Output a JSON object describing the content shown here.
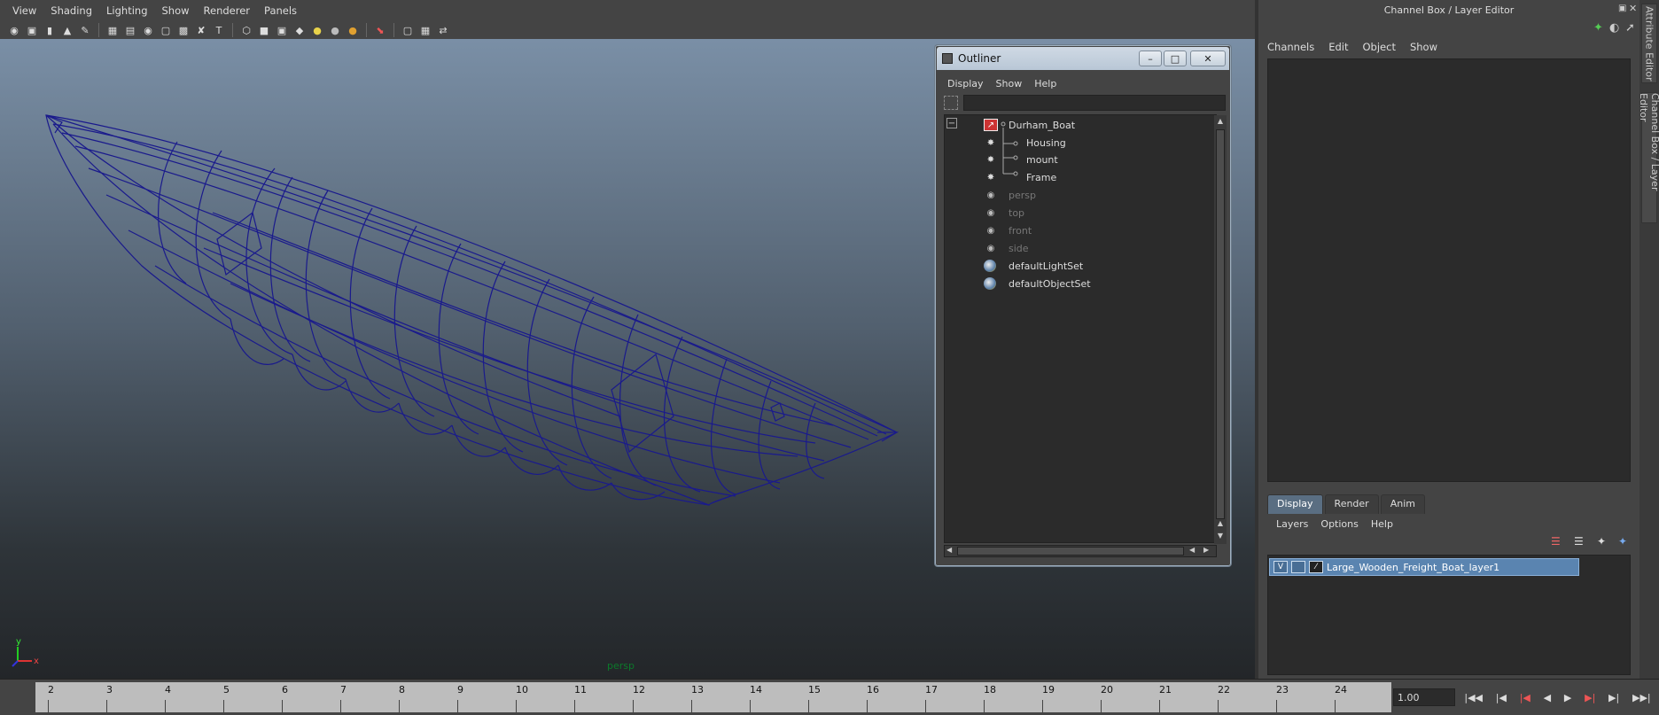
{
  "viewport": {
    "menus": [
      "View",
      "Shading",
      "Lighting",
      "Show",
      "Renderer",
      "Panels"
    ],
    "camera_label": "persp",
    "axis": {
      "y": "y",
      "x": "x"
    }
  },
  "outliner": {
    "title": "Outliner",
    "menus": [
      "Display",
      "Show",
      "Help"
    ],
    "items": [
      {
        "label": "Durham_Boat",
        "icon": "transform-icon"
      },
      {
        "label": "Housing",
        "icon": "group-icon"
      },
      {
        "label": "mount",
        "icon": "group-icon"
      },
      {
        "label": "Frame",
        "icon": "group-icon"
      },
      {
        "label": "persp",
        "icon": "camera-icon"
      },
      {
        "label": "top",
        "icon": "camera-icon"
      },
      {
        "label": "front",
        "icon": "camera-icon"
      },
      {
        "label": "side",
        "icon": "camera-icon"
      },
      {
        "label": "defaultLightSet",
        "icon": "set-icon"
      },
      {
        "label": "defaultObjectSet",
        "icon": "set-icon"
      }
    ],
    "collapse_toggle": "−",
    "window_buttons": {
      "minimize": "–",
      "maximize": "□",
      "close": "✕"
    }
  },
  "channel_box": {
    "title": "Channel Box / Layer Editor",
    "menus": [
      "Channels",
      "Edit",
      "Object",
      "Show"
    ]
  },
  "layer_editor": {
    "tabs": [
      "Display",
      "Render",
      "Anim"
    ],
    "active_tab": "Display",
    "menus": [
      "Layers",
      "Options",
      "Help"
    ],
    "layer": {
      "visible": "V",
      "name": "Large_Wooden_Freight_Boat_layer1"
    }
  },
  "side_tabs": [
    "Attribute Editor",
    "Channel Box / Layer Editor"
  ],
  "timeline": {
    "frames": [
      "2",
      "3",
      "4",
      "5",
      "6",
      "7",
      "8",
      "9",
      "10",
      "11",
      "12",
      "13",
      "14",
      "15",
      "16",
      "17",
      "18",
      "19",
      "20",
      "21",
      "22",
      "23",
      "24"
    ],
    "current_frame": "1.00"
  },
  "colors": {
    "wireframe": "#1a1a8c",
    "selected_layer": "#5a84b0",
    "camera_label": "#0b7a2a"
  }
}
